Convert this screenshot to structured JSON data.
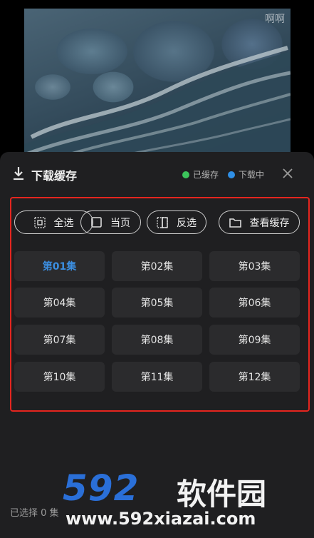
{
  "video": {
    "corner_text": "啊啊"
  },
  "sheet": {
    "title": "下载缓存",
    "legend": [
      {
        "label": "已缓存",
        "color": "#3cc45b"
      },
      {
        "label": "下载中",
        "color": "#2f8fe6"
      }
    ],
    "actions": {
      "select_all": "全选",
      "current_page": "当页",
      "invert": "反选",
      "view_cache": "查看缓存"
    },
    "episodes": [
      "第01集",
      "第02集",
      "第03集",
      "第04集",
      "第05集",
      "第06集",
      "第07集",
      "第08集",
      "第09集",
      "第10集",
      "第11集",
      "第12集"
    ],
    "active_episode": "第01集",
    "selected_text": "已选择 0 集"
  },
  "site_watermark": {
    "number": "592",
    "name": "软件园",
    "url": "www.592xiazai.com"
  },
  "colors": {
    "highlight_frame": "#e5251f",
    "active_episode": "#3b8ee0",
    "sheet_bg": "#1f1f21"
  }
}
